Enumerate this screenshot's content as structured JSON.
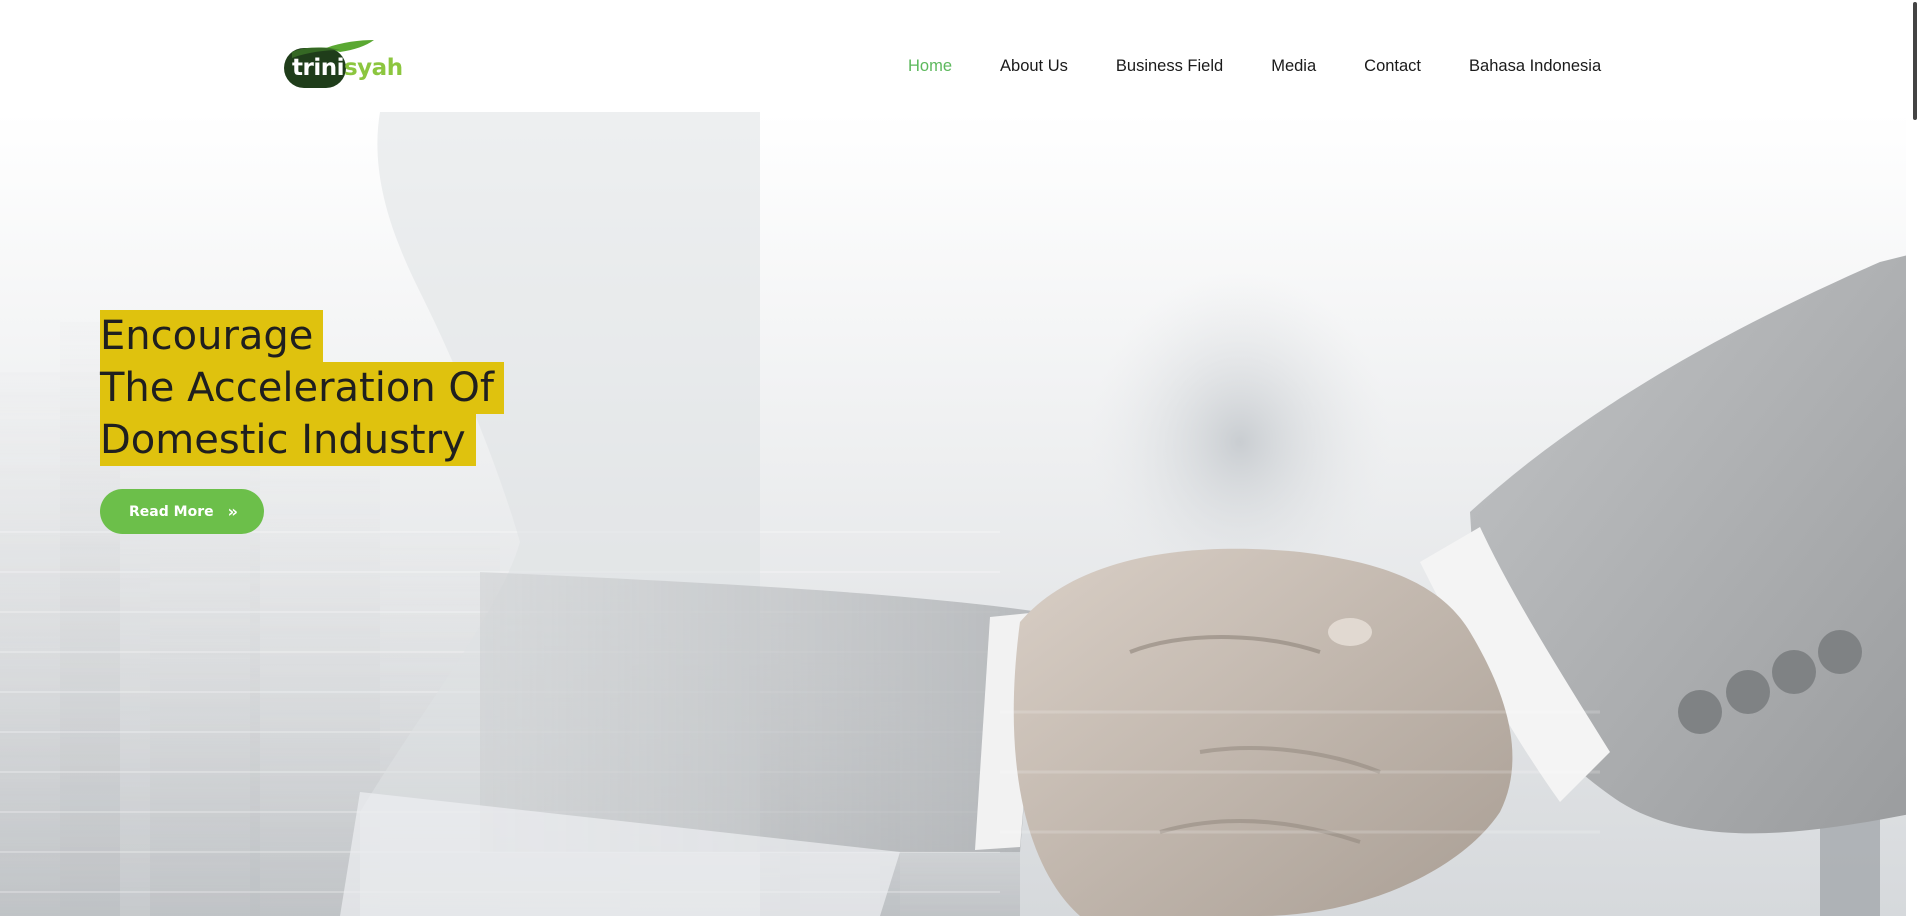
{
  "brand": {
    "logo_part1": "trini",
    "logo_part2": "syah",
    "leaf_color": "#5aa832",
    "badge_color": "#1f3d1a"
  },
  "nav": {
    "items": [
      {
        "label": "Home",
        "active": true
      },
      {
        "label": "About Us"
      },
      {
        "label": "Business Field"
      },
      {
        "label": "Media"
      },
      {
        "label": "Contact"
      },
      {
        "label": "Bahasa Indonesia"
      }
    ],
    "active_color": "#5cb85c"
  },
  "hero": {
    "title_lines": [
      "Encourage",
      "The Acceleration Of",
      "Domestic Industry"
    ],
    "highlight_color": "#dfc20e",
    "button": {
      "label": "Read More",
      "icon": "double-chevron-right-icon",
      "color": "#6cbf4a"
    },
    "background_image": "handshake-over-city-skyline"
  }
}
